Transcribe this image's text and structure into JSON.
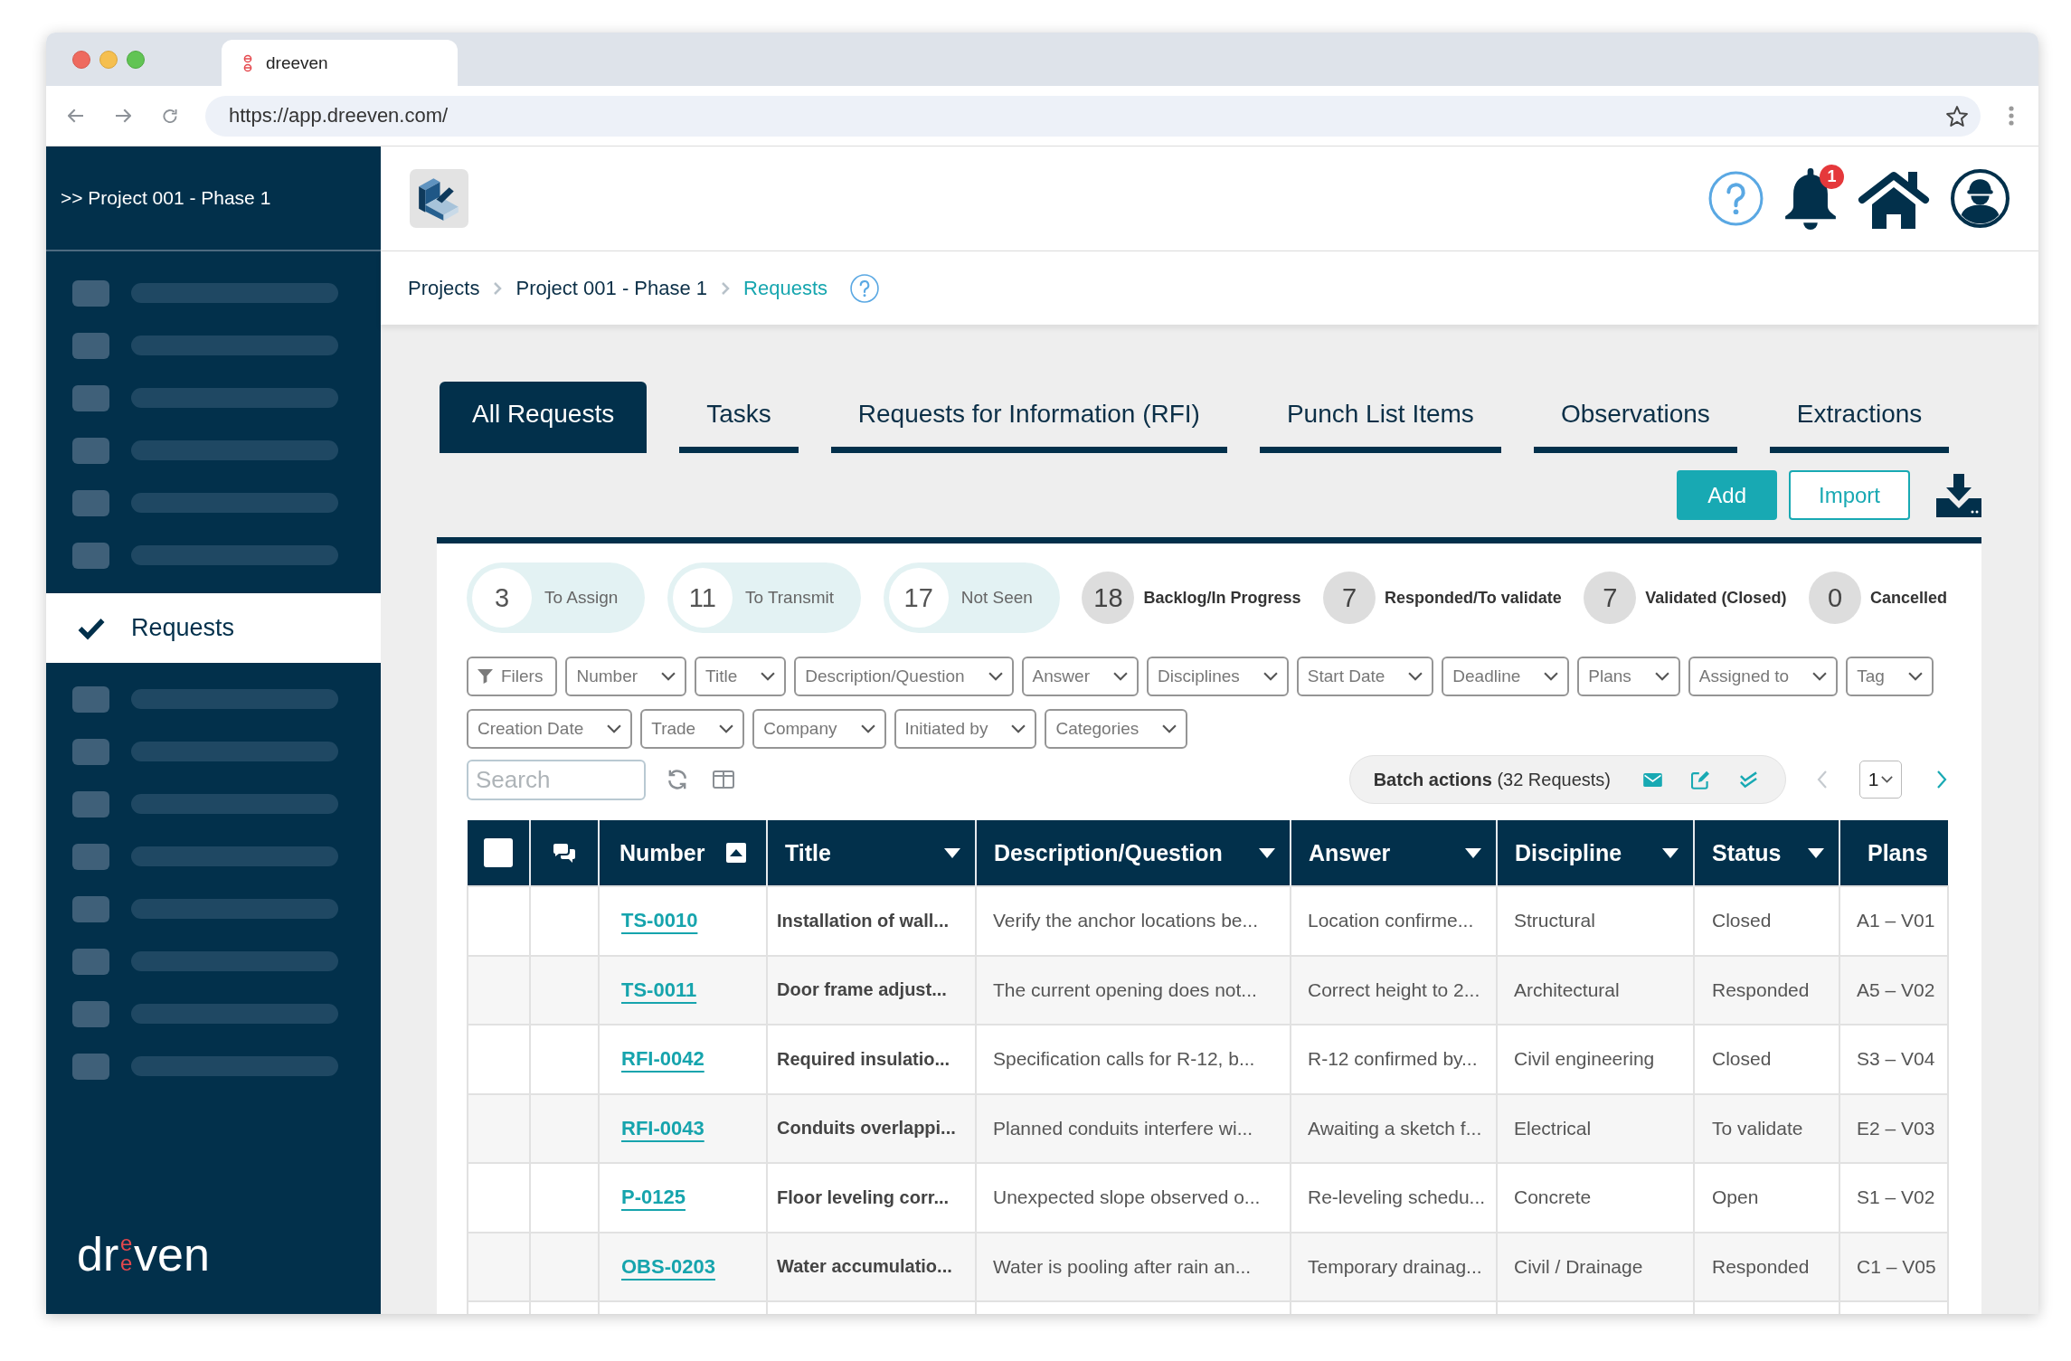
{
  "browser": {
    "tab": {
      "title": "dreeven"
    },
    "url": "https://app.dreeven.com/"
  },
  "sidebar": {
    "project": ">> Project 001 - Phase 1",
    "items": [
      {
        "kind": "placeholder",
        "selected": false
      },
      {
        "kind": "placeholder",
        "selected": false
      },
      {
        "kind": "placeholder",
        "selected": false
      },
      {
        "kind": "placeholder",
        "selected": false
      },
      {
        "kind": "placeholder",
        "selected": false
      },
      {
        "kind": "placeholder",
        "selected": false
      },
      {
        "kind": "link",
        "label": "Requests",
        "selected": true
      },
      {
        "kind": "placeholder",
        "selected": false
      },
      {
        "kind": "placeholder",
        "selected": false
      },
      {
        "kind": "placeholder",
        "selected": false
      },
      {
        "kind": "placeholder",
        "selected": false
      },
      {
        "kind": "placeholder",
        "selected": false
      },
      {
        "kind": "placeholder",
        "selected": false
      },
      {
        "kind": "placeholder",
        "selected": false
      },
      {
        "kind": "placeholder",
        "selected": false
      }
    ],
    "logo": {
      "start": "dr",
      "stacked": "ee",
      "end": "ven"
    }
  },
  "header": {
    "notification_count": "1"
  },
  "breadcrumb": [
    {
      "label": "Projects",
      "current": false
    },
    {
      "label": "Project 001 - Phase 1",
      "current": false
    },
    {
      "label": "Requests",
      "current": true
    }
  ],
  "tabs": [
    {
      "label": "All Requests",
      "selected": true
    },
    {
      "label": "Tasks",
      "selected": false
    },
    {
      "label": "Requests for Information (RFI)",
      "selected": false
    },
    {
      "label": "Punch List Items",
      "selected": false
    },
    {
      "label": "Observations",
      "selected": false
    },
    {
      "label": "Extractions",
      "selected": false
    }
  ],
  "actions": [
    {
      "kind": "primary",
      "label": "Add"
    },
    {
      "kind": "secondary",
      "label": "Import"
    }
  ],
  "status_counters": [
    {
      "kind": "highlighted",
      "count": "3",
      "label": "To Assign"
    },
    {
      "kind": "highlighted",
      "count": "11",
      "label": "To Transmit"
    },
    {
      "kind": "highlighted",
      "count": "17",
      "label": "Not Seen"
    },
    {
      "kind": "plain",
      "count": "18",
      "label": "Backlog/In Progress"
    },
    {
      "kind": "plain",
      "count": "7",
      "label": "Responded/To validate"
    },
    {
      "kind": "plain",
      "count": "7",
      "label": "Validated (Closed)"
    },
    {
      "kind": "plain",
      "count": "0",
      "label": "Cancelled"
    }
  ],
  "filter_rows": [
    {
      "filters": [
        {
          "kind": "button",
          "label": "Filers"
        },
        {
          "kind": "dropdown",
          "label": "Number"
        },
        {
          "kind": "dropdown",
          "label": "Title"
        },
        {
          "kind": "dropdown",
          "label": "Description/Question"
        },
        {
          "kind": "dropdown",
          "label": "Answer"
        },
        {
          "kind": "dropdown",
          "label": "Disciplines"
        },
        {
          "kind": "dropdown",
          "label": "Start Date"
        },
        {
          "kind": "dropdown",
          "label": "Deadline"
        },
        {
          "kind": "dropdown",
          "label": "Plans"
        },
        {
          "kind": "dropdown",
          "label": "Assigned to"
        },
        {
          "kind": "dropdown",
          "label": "Tag"
        }
      ]
    },
    {
      "filters": [
        {
          "kind": "dropdown",
          "label": "Creation Date"
        },
        {
          "kind": "dropdown",
          "label": "Trade"
        },
        {
          "kind": "dropdown",
          "label": "Company"
        },
        {
          "kind": "dropdown",
          "label": "Initiated by"
        },
        {
          "kind": "dropdown",
          "label": "Categories"
        }
      ]
    }
  ],
  "search": {
    "placeholder": "Search"
  },
  "batch_actions": {
    "label": "**Batch actions** (32 Requests)"
  },
  "pagination": {
    "page": "1",
    "previous_disabled": true,
    "next_disabled": false
  },
  "table": {
    "columns": [
      {
        "kind": "checkbox",
        "checked": false
      },
      {
        "kind": "icon"
      },
      {
        "kind": "link",
        "label": "Number",
        "sorted": true,
        "menu": false
      },
      {
        "kind": "emphasis",
        "label": "Title",
        "sorted": false,
        "menu": true
      },
      {
        "kind": "text",
        "label": "Description/Question",
        "sorted": false,
        "menu": true
      },
      {
        "kind": "text",
        "label": "Answer",
        "sorted": false,
        "menu": true
      },
      {
        "kind": "text",
        "label": "Discipline",
        "sorted": false,
        "menu": true
      },
      {
        "kind": "text",
        "label": "Status",
        "sorted": false,
        "menu": true
      },
      {
        "kind": "text",
        "label": "Plans",
        "sorted": false,
        "menu": false
      }
    ],
    "rows": [
      {
        "cells": [
          "",
          "",
          "TS-0010",
          "Installation of wall...",
          "Verify the anchor locations be...",
          "Location confirme...",
          "Structural",
          "Closed",
          "A1 – V01"
        ]
      },
      {
        "cells": [
          "",
          "",
          "TS-0011",
          "Door frame adjust...",
          "The current opening does not...",
          "Correct height to 2...",
          "Architectural",
          "Responded",
          "A5 – V02"
        ]
      },
      {
        "cells": [
          "",
          "",
          "RFI-0042",
          "Required insulatio...",
          "Specification calls for R-12, b...",
          "R-12 confirmed by...",
          "Civil engineering",
          "Closed",
          "S3 – V04"
        ]
      },
      {
        "cells": [
          "",
          "",
          "RFI-0043",
          "Conduits overlappi...",
          "Planned conduits interfere wi...",
          "Awaiting a sketch f...",
          "Electrical",
          "To validate",
          "E2 – V03"
        ]
      },
      {
        "cells": [
          "",
          "",
          "P-0125",
          "Floor leveling corr...",
          "Unexpected slope observed o...",
          "Re-leveling schedu...",
          "Concrete",
          "Open",
          "S1 – V02"
        ]
      },
      {
        "cells": [
          "",
          "",
          "OBS-0203",
          "Water accumulatio...",
          "Water is pooling after rain an...",
          "Temporary drainag...",
          "Civil / Drainage",
          "Responded",
          "C1 – V05"
        ]
      }
    ]
  }
}
